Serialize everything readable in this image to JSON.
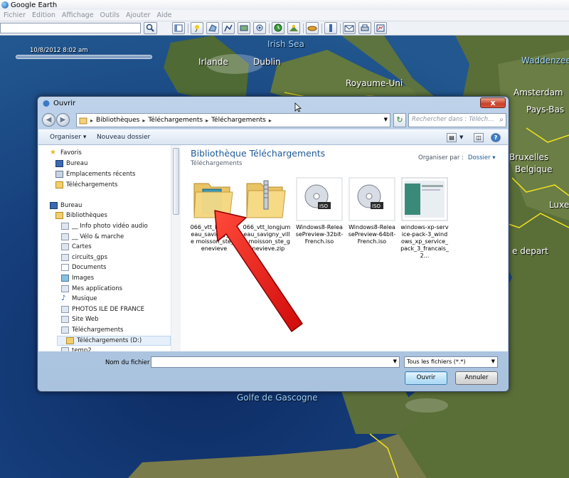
{
  "app": {
    "title": "Google Earth",
    "menu": [
      "Fichier",
      "Edition",
      "Affichage",
      "Outils",
      "Ajouter",
      "Aide"
    ]
  },
  "map": {
    "date": "10/8/2012   8:02 am",
    "labels": {
      "irish_sea": "Irish Sea",
      "irlande": "Irlande",
      "dublin": "Dublin",
      "royaume_uni": "Royaume-Uni",
      "waddenzee": "Waddenzee",
      "amsterdam": "Amsterdam",
      "pays_bas": "Pays-Bas",
      "bruxelles": "Bruxelles",
      "belgique": "Belgique",
      "luxembourg_partial": "Luxe",
      "depart_partial": "e depart",
      "golfe": "Golfe de Gascogne"
    }
  },
  "dialog": {
    "title": "Ouvrir",
    "close_label": "x",
    "breadcrumb": [
      "Bibliothèques",
      "Téléchargements",
      "Téléchargements"
    ],
    "search_placeholder": "Rechercher dans : Téléchargements",
    "toolbar": {
      "organize": "Organiser ▾",
      "new_folder": "Nouveau dossier"
    },
    "nav_tree": [
      {
        "label": "Favoris",
        "icon": "star-icon"
      },
      {
        "label": "Bureau",
        "icon": "desktop-icon"
      },
      {
        "label": "Emplacements récents",
        "icon": "recent-icon"
      },
      {
        "label": "Téléchargements",
        "icon": "download-folder-icon"
      },
      {
        "label": "Bureau",
        "icon": "desktop-icon"
      },
      {
        "label": "Bibliothèques",
        "icon": "library-icon"
      },
      {
        "label": "__ Info photo vidéo audio",
        "icon": "folder-icon"
      },
      {
        "label": "__ Vélo & marche",
        "icon": "folder-icon"
      },
      {
        "label": "Cartes",
        "icon": "folder-icon"
      },
      {
        "label": "circuits_gps",
        "icon": "folder-icon"
      },
      {
        "label": "Documents",
        "icon": "documents-icon"
      },
      {
        "label": "Images",
        "icon": "images-icon"
      },
      {
        "label": "Mes applications",
        "icon": "folder-icon"
      },
      {
        "label": "Musique",
        "icon": "music-icon"
      },
      {
        "label": "PHOTOS ILE DE FRANCE",
        "icon": "folder-icon"
      },
      {
        "label": "Site Web",
        "icon": "folder-icon"
      },
      {
        "label": "Téléchargements",
        "icon": "download-folder-icon"
      },
      {
        "label": "Téléchargements (D:)",
        "icon": "folder-icon"
      },
      {
        "label": "temp2",
        "icon": "folder-icon"
      }
    ],
    "library": {
      "title": "Bibliothèque Téléchargements",
      "subtitle": "Téléchargements",
      "arrange_label": "Organiser par :",
      "arrange_value": "Dossier ▾"
    },
    "files": [
      {
        "name": "066_vtt_longjumeau_savigny_ville moisson_ste_genevieve",
        "icon": "folder-icon"
      },
      {
        "name": "066_vtt_longjumeau_savigny_ville moisson_ste_genevieve.zip",
        "icon": "zip-folder-icon"
      },
      {
        "name": "Windows8-ReleasePreview-32bit-French.iso",
        "icon": "iso-disc-icon"
      },
      {
        "name": "Windows8-ReleasePreview-64bit-French.iso",
        "icon": "iso-disc-icon"
      },
      {
        "name": "windows-xp-service-pack-3_windows_xp_service_pack_3_francais_2...",
        "icon": "document-thumbnail-icon"
      }
    ],
    "footer": {
      "filename_label": "Nom du fichier :",
      "filename_value": "",
      "filter": "Tous les fichiers (*.*)",
      "open": "Ouvrir",
      "cancel": "Annuler"
    }
  },
  "colors": {
    "title_blue": "#1e5a96",
    "arrow_red": "#e01010",
    "close_red": "#c9432c"
  }
}
